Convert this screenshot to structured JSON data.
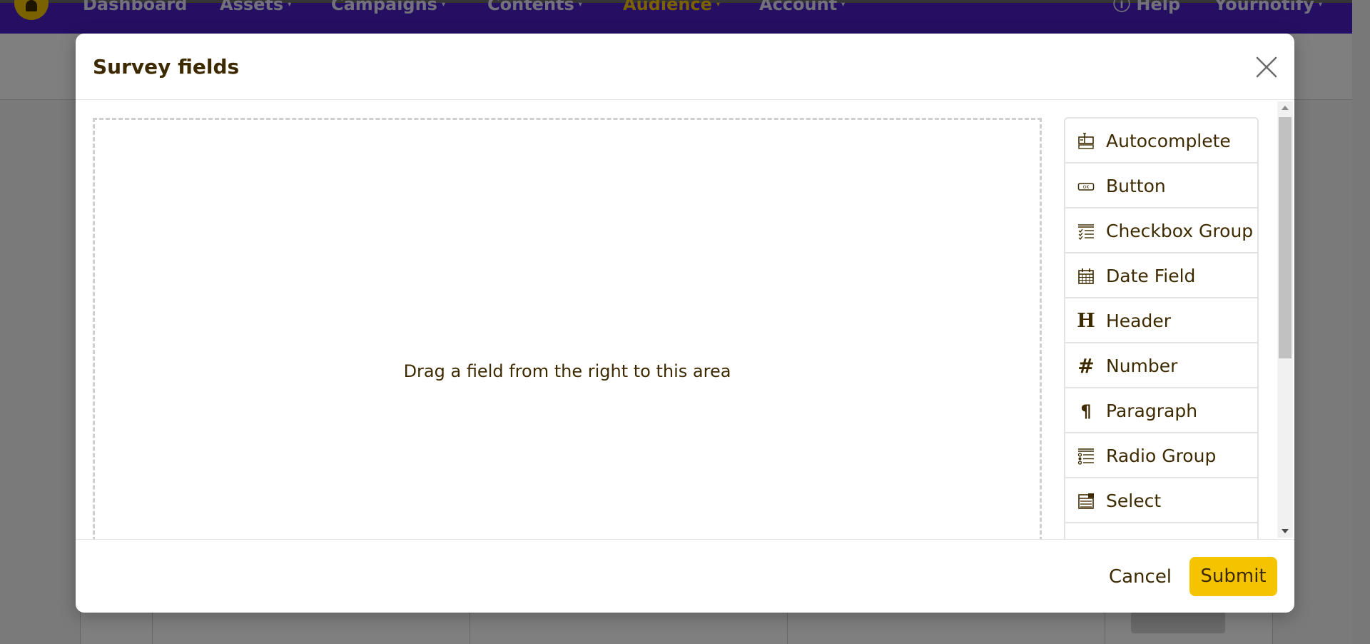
{
  "app": {
    "nav_items": [
      {
        "label": "Dashboard",
        "active": false
      },
      {
        "label": "Assets",
        "active": false
      },
      {
        "label": "Campaigns",
        "active": false
      },
      {
        "label": "Contents",
        "active": false
      },
      {
        "label": "Audience",
        "active": true
      },
      {
        "label": "Account",
        "active": false
      }
    ],
    "help_label": "Help",
    "brand_label": "Yournotify"
  },
  "modal": {
    "title": "Survey fields",
    "dropzone_text": "Drag a field from the right to this area",
    "fields": [
      {
        "label": "Autocomplete",
        "icon": "autocomplete-icon"
      },
      {
        "label": "Button",
        "icon": "button-icon"
      },
      {
        "label": "Checkbox Group",
        "icon": "checkbox-group-icon"
      },
      {
        "label": "Date Field",
        "icon": "calendar-icon"
      },
      {
        "label": "Header",
        "icon": "header-icon"
      },
      {
        "label": "Number",
        "icon": "hash-icon"
      },
      {
        "label": "Paragraph",
        "icon": "paragraph-icon"
      },
      {
        "label": "Radio Group",
        "icon": "radio-group-icon"
      },
      {
        "label": "Select",
        "icon": "select-icon"
      }
    ],
    "cancel_label": "Cancel",
    "submit_label": "Submit"
  },
  "colors": {
    "nav_bg": "#4b1fc4",
    "accent_yellow": "#f5c400",
    "text_brown": "#3e2a00",
    "overlay": "rgba(0,0,0,0.5)"
  }
}
